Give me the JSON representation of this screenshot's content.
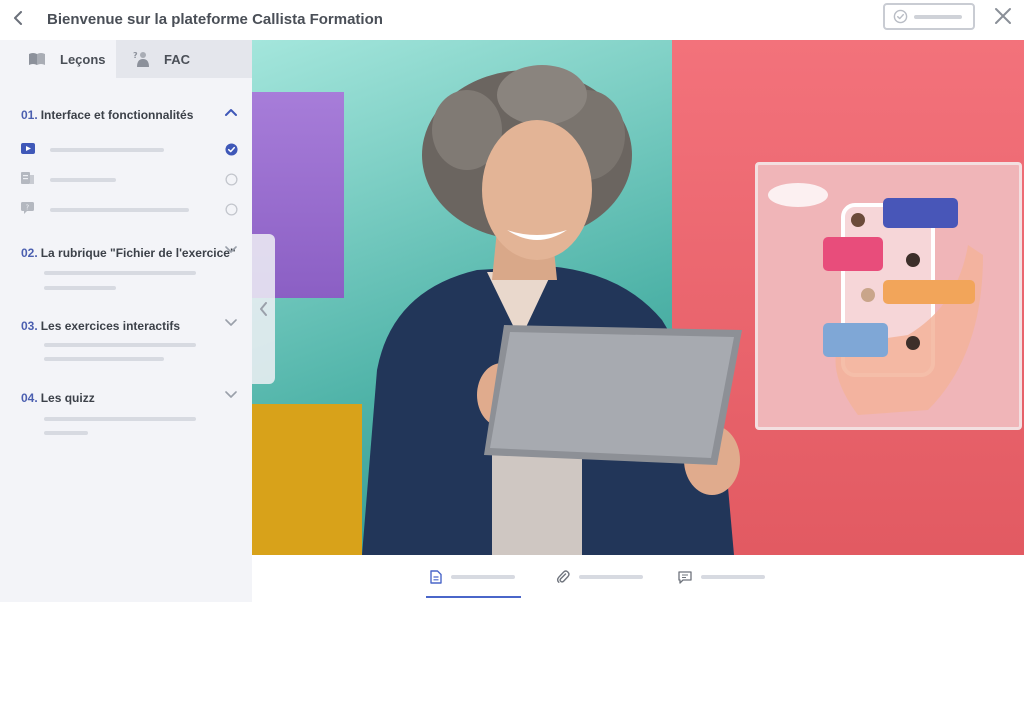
{
  "header": {
    "title": "Bienvenue sur la plateforme Callista Formation"
  },
  "sidebar": {
    "tabs": [
      {
        "label": "Leçons"
      },
      {
        "label": "FAC"
      }
    ],
    "sections": [
      {
        "number": "01.",
        "title": "Interface et fonctionnalités",
        "expanded": true
      },
      {
        "number": "02.",
        "title": "La rubrique \"Fichier de l'exercice\"",
        "expanded": false
      },
      {
        "number": "03.",
        "title": "Les exercices interactifs",
        "expanded": false
      },
      {
        "number": "04.",
        "title": "Les quizz",
        "expanded": false
      }
    ],
    "lessons": [
      {
        "type": "video-icon",
        "completed": true
      },
      {
        "type": "document-icon",
        "completed": false
      },
      {
        "type": "quiz-icon",
        "completed": false
      }
    ]
  },
  "colors": {
    "accent": "#4a66c9",
    "sidebar_bg": "#f3f4f8",
    "tab_inactive_bg": "#e4e6ec",
    "placeholder": "#d7dae1"
  },
  "icons": {
    "back": "chevron-left-icon",
    "progress": "check-circle-icon",
    "close": "close-icon",
    "bottom_tabs": [
      "document-icon",
      "paperclip-icon",
      "comment-icon"
    ]
  }
}
